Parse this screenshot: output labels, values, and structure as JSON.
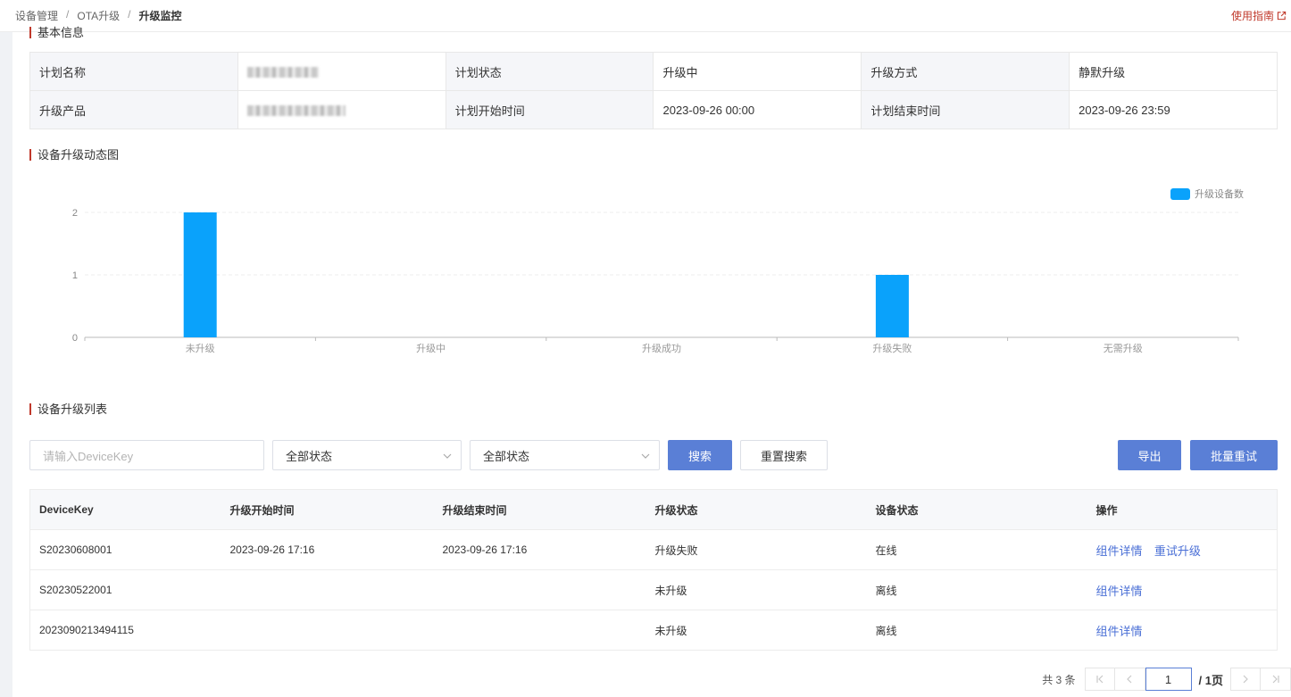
{
  "breadcrumb": [
    "设备管理",
    "OTA升级",
    "升级监控"
  ],
  "guide_link": "使用指南",
  "sections": {
    "basic_info": "基本信息",
    "chart": "设备升级动态图",
    "list": "设备升级列表"
  },
  "info": {
    "plan_name_label": "计划名称",
    "plan_status_label": "计划状态",
    "plan_status": "升级中",
    "upgrade_mode_label": "升级方式",
    "upgrade_mode": "静默升级",
    "product_label": "升级产品",
    "start_time_label": "计划开始时间",
    "start_time": "2023-09-26 00:00",
    "end_time_label": "计划结束时间",
    "end_time": "2023-09-26 23:59"
  },
  "chart_data": {
    "type": "bar",
    "categories": [
      "未升级",
      "升级中",
      "升级成功",
      "升级失败",
      "无需升级"
    ],
    "series": [
      {
        "name": "升级设备数",
        "values": [
          2,
          0,
          0,
          1,
          0
        ]
      }
    ],
    "yticks": [
      "0",
      "1",
      "2"
    ],
    "ylim": [
      0,
      2
    ],
    "legend_position": "top-right",
    "color": "#0aa2fb",
    "grid": true
  },
  "filters": {
    "devicekey_placeholder": "请输入DeviceKey",
    "status1": "全部状态",
    "status2": "全部状态",
    "search": "搜索",
    "reset": "重置搜索",
    "export": "导出",
    "batch_retry": "批量重试"
  },
  "table": {
    "headers": [
      "DeviceKey",
      "升级开始时间",
      "升级结束时间",
      "升级状态",
      "设备状态",
      "操作"
    ],
    "rows": [
      {
        "key": "S20230608001",
        "start": "2023-09-26 17:16",
        "end": "2023-09-26 17:16",
        "status": "升级失败",
        "device": "在线",
        "action1": "组件详情",
        "action2": "重试升级"
      },
      {
        "key": "S20230522001",
        "start": "",
        "end": "",
        "status": "未升级",
        "device": "离线",
        "action1": "组件详情",
        "action2": ""
      },
      {
        "key": "2023090213494115",
        "start": "",
        "end": "",
        "status": "未升级",
        "device": "离线",
        "action1": "组件详情",
        "action2": ""
      }
    ]
  },
  "pagination": {
    "total": "共 3 条",
    "current": "1",
    "pages": "/ 1页"
  }
}
